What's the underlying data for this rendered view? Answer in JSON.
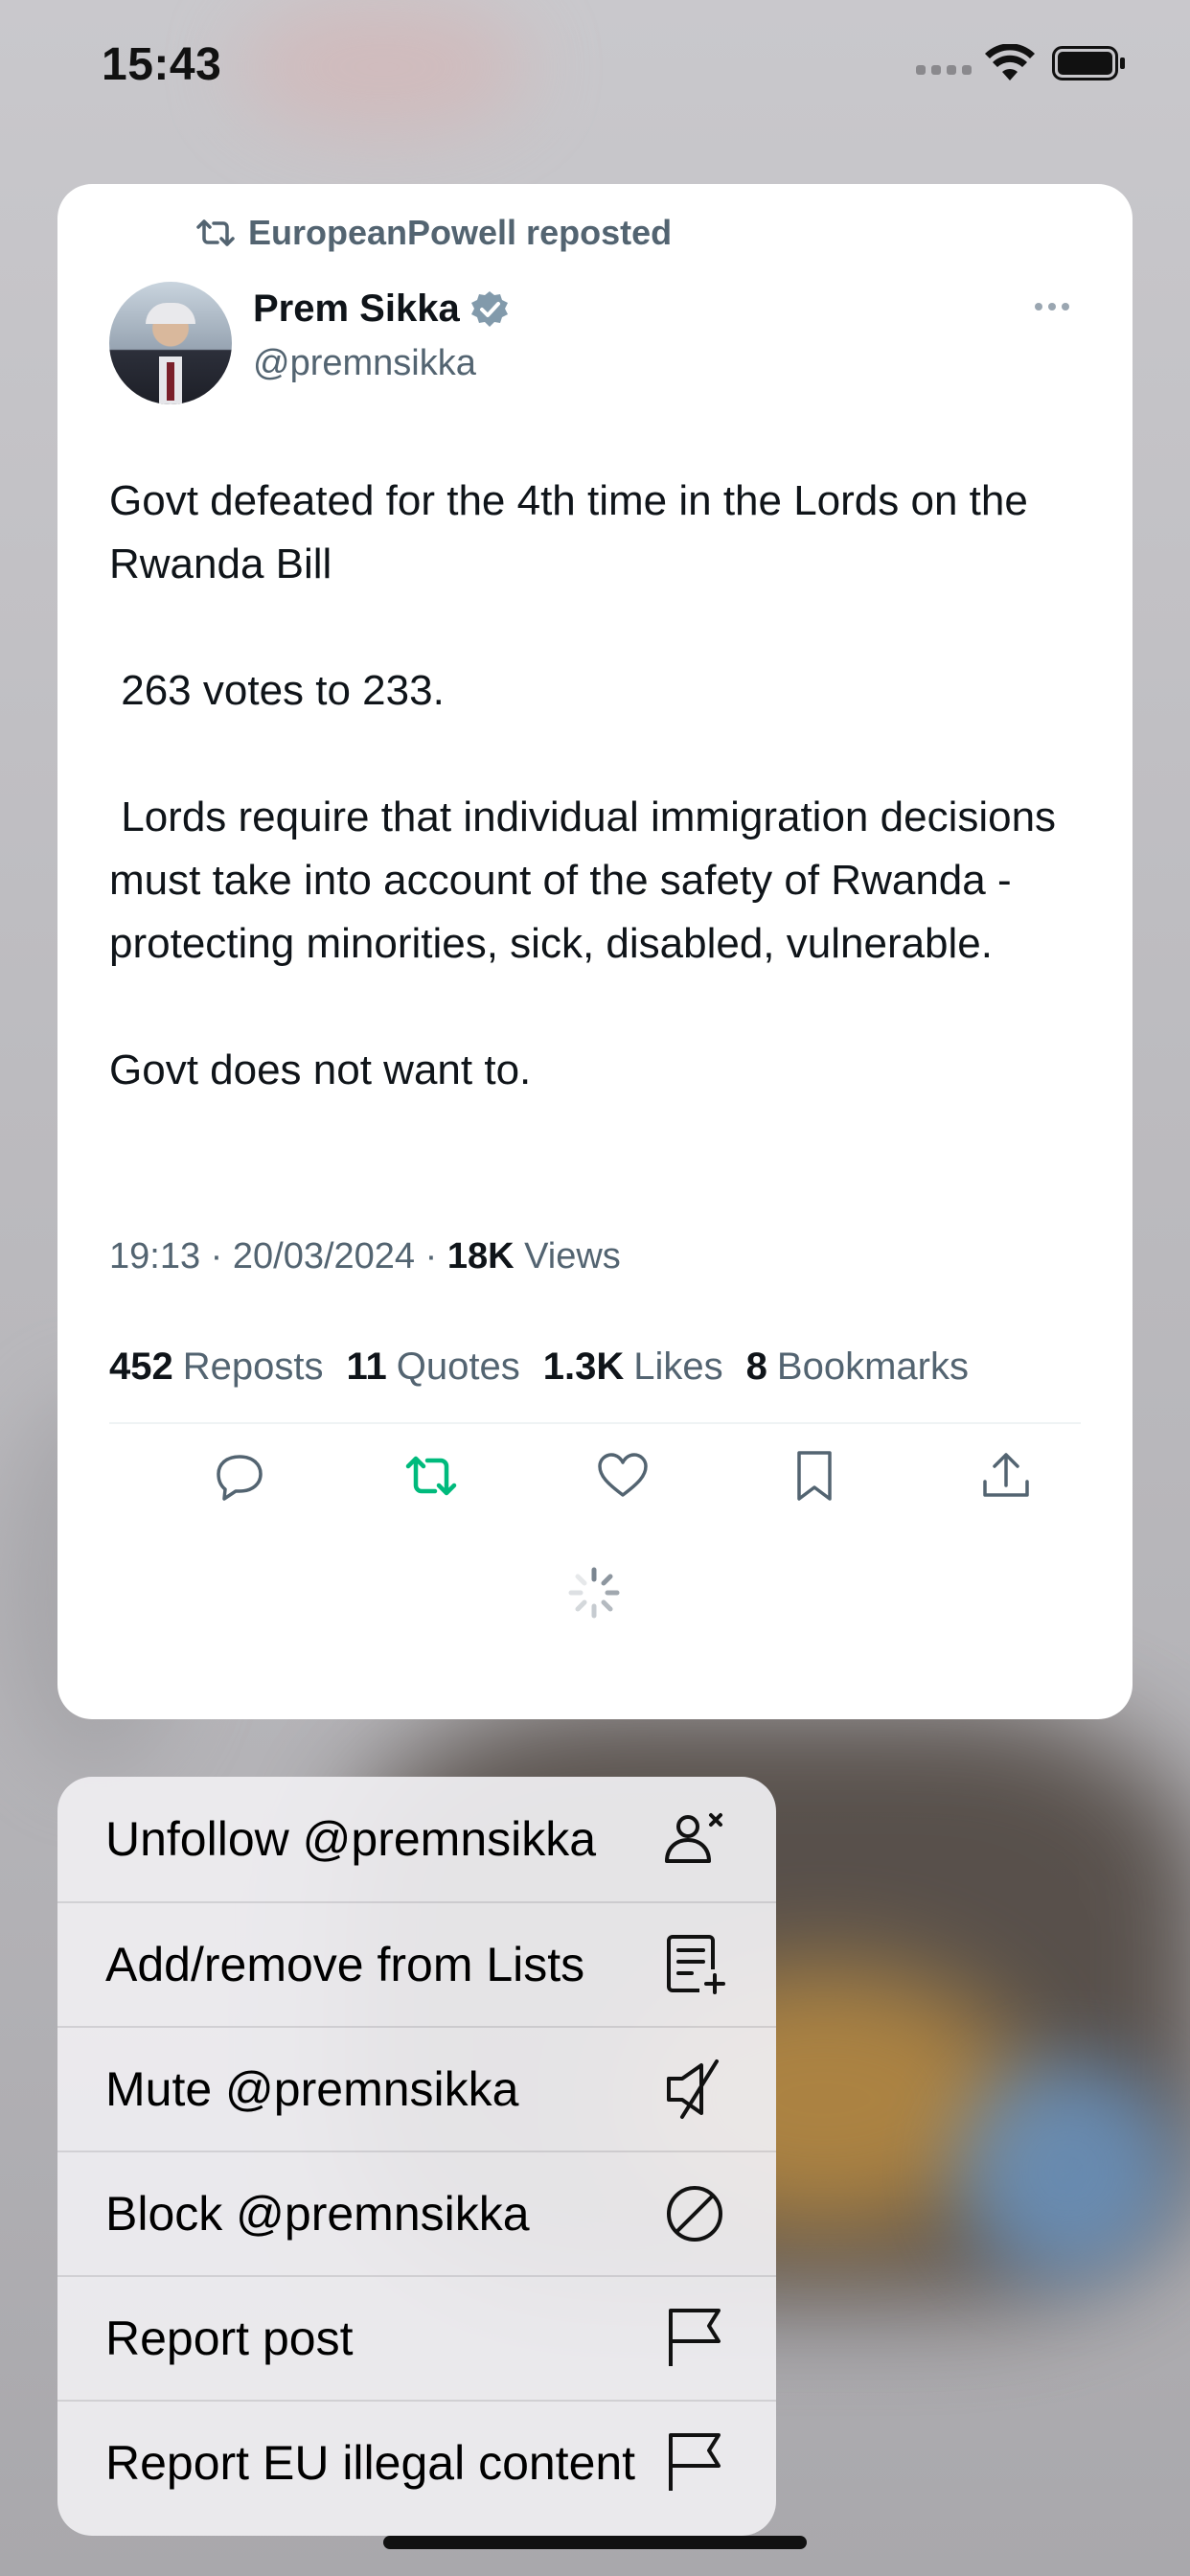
{
  "status_bar": {
    "time": "15:43"
  },
  "post": {
    "repost_label": "EuropeanPowell reposted",
    "author_name": "Prem Sikka",
    "author_handle": "@premnsikka",
    "verified": true,
    "text": "Govt defeated for the 4th time in the Lords on the Rwanda Bill\n\n 263 votes to 233.\n\n Lords require that individual immigration decisions must take into account of the safety of Rwanda - protecting minorities, sick, disabled, vulnerable.\n\nGovt does not want to.",
    "timestamp": "19:13 · 20/03/2024 ·",
    "views_count": "18K",
    "views_label": "Views",
    "stats": [
      {
        "count": "452",
        "label": "Reposts"
      },
      {
        "count": "11",
        "label": "Quotes"
      },
      {
        "count": "1.3K",
        "label": "Likes"
      },
      {
        "count": "8",
        "label": "Bookmarks"
      }
    ],
    "actions": [
      "reply-icon",
      "repost-icon",
      "like-icon",
      "bookmark-icon",
      "share-icon"
    ],
    "repost_color": "#00ba7c",
    "icon_color": "#536471"
  },
  "menu": {
    "items": [
      {
        "label": "Unfollow @premnsikka",
        "icon": "unfollow-icon"
      },
      {
        "label": "Add/remove from Lists",
        "icon": "list-add-icon"
      },
      {
        "label": "Mute @premnsikka",
        "icon": "mute-icon"
      },
      {
        "label": "Block @premnsikka",
        "icon": "block-icon"
      },
      {
        "label": "Report post",
        "icon": "flag-icon"
      },
      {
        "label": "Report EU illegal content",
        "icon": "flag-icon"
      }
    ]
  }
}
